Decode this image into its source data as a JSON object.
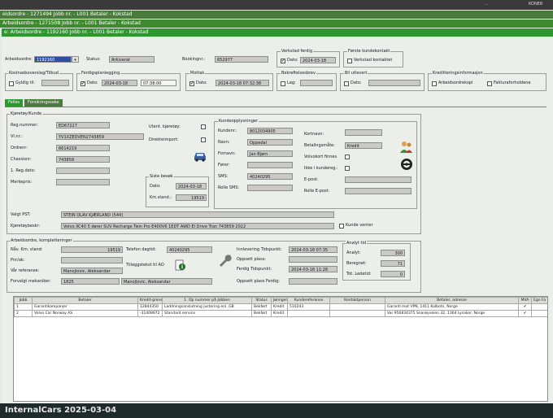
{
  "top_right": {
    "label_1": "...",
    "label_2": "KONER"
  },
  "windows": [
    "eidsordre - 1271494 Jobb nr. - L001 Betaler - Kokstad",
    "Arbeidsordre - 1271508 Jobb nr. - L001 Betaler - Kokstad",
    "e: Arbeidsordre - 1192160 Jobb nr. - L001 Betaler - Kokstad"
  ],
  "header": {
    "arbeidsordre_label": "Arbeidsordre:",
    "arbeidsordre_value": "1192160",
    "status_label": "Status:",
    "status_value": "Arkiverat",
    "bookingnr_label": "Bookingnr.:",
    "bookingnr_value": "652977",
    "verkstad_ferdig": {
      "title": "Verkstad ferdig",
      "dato_label": "Dato:",
      "dato_value": "2024-03-18"
    },
    "forste_kundekontakt": {
      "title": "Første kundekontakt",
      "check_label": "Verkstad kontaktet"
    },
    "kostnadsoverslag": {
      "title": "Kostnadsoverslag/Tilbud",
      "gyldig_label": "Gyldig til:"
    },
    "ferdigplanlegging": {
      "title": "Ferdigsplanlegging",
      "dato_label": "Dato:",
      "dato_value": "2024-03-18",
      "time_value": "07:38:00"
    },
    "mottak": {
      "title": "Mottak",
      "dato_label": "Dato:",
      "dato_value": "2024-03-18 07:32:38"
    },
    "bekreftelsesbrev": {
      "title": "Bekreftelsesbrev",
      "lag_label": "Lag:"
    },
    "bil_utlevert": {
      "title": "Bil utlevert",
      "dato_label": "Dato:"
    },
    "kredittering": {
      "title": "Kreditteringsinformasjon",
      "check1": "Arbeidsordrekopi",
      "check2": "Fakturaforholdene"
    }
  },
  "tabs": [
    "Felles",
    "Forsikringssake"
  ],
  "kjoretoy": {
    "section_title": "Kjøretøy/Kunde",
    "reg_label": "Reg.nummer:",
    "reg_value": "ED67227",
    "vin_label": "Vl.nr.:",
    "vin_value": "YV1XZEDVEN2743859",
    "ordrenr_label": "Ordrenr:",
    "ordrenr_value": "6614219",
    "chassis_label": "Chassisnr:",
    "chassis_value": "743859",
    "regdato_label": "1. Reg.dato:",
    "merkepris_label": "Merkepris:",
    "utent_label": "Utent. kjøretøy:",
    "direkteimport_label": "Direkteimport:",
    "siste_besok_title": "Siste besøk",
    "siste_dato_label": "Dato:",
    "siste_dato_value": "2024-03-18",
    "km_label": "Km.stand.:",
    "km_value": "19519",
    "valgt_pst_label": "Valgt PST:",
    "valgt_pst_value": "STEIN OLAV KJÆRLAND (544)",
    "beskr_label": "Kjøretøybeskr:",
    "beskr_value": "Volvo XC40 5 dører SUV Recharge Twin Pro E400V6 1EDT AWD El Drive Tran 743859  2022",
    "kunde_venter_label": "Kunde venter"
  },
  "kunde": {
    "title": "Kundeopplysninger",
    "kundenr_label": "Kundenr.:",
    "kundenr_value": "8012034905",
    "navn_label": "Navn:",
    "navn_value": "Oppedal",
    "fornavn_label": "Fornavn:",
    "fornavn_value": "Jan Bjørn",
    "forer_label": "Fører:",
    "sms_label": "SMS:",
    "sms_value": "40240295",
    "rolle_sms_label": "Rolle SMS:",
    "kortnavn_label": "Kortnavn:",
    "betalingsmate_label": "Betalingsmåte:",
    "betalingsmate_value": "Kredit",
    "volvokort_label": "Volvokort finnes",
    "ikke_kundereg_label": "Ikke i kundereg.:",
    "epost_label": "E-post:",
    "rolle_epost_label": "Rolle E-post:"
  },
  "arbeidsordre_kompl": {
    "title": "Arbeidsordre, kompletteringer",
    "km_label": "Nåv. Km. stand:",
    "km_value": "19519",
    "telefon_label": "Telefon dagtid:",
    "telefon_value": "40240295",
    "pnr_label": "Pnr/ak:",
    "var_ref_label": "Vår referanse:",
    "var_ref_value": "Manojlovic, Aleksandar",
    "tilleggstekst_label": "Tilleggstekst til AO",
    "forvalgt_label": "Forvalgt mekaniker:",
    "forvalgt_code": "1825",
    "forvalgt_value": "Manojlovic, Aleksandar",
    "innlevering_label": "Innlevering Tidspunkt:",
    "innlevering_value": "2024-03-18 07:35",
    "oppsett_label": "Oppsett plass:",
    "ferdig_label": "Ferdig Tidspunkt:",
    "ferdig_value": "2024-03-18 11:28",
    "oppsett_ferdig_label": "Oppsett plass Ferdig:",
    "analyt_title": "Analyt tid",
    "analyt_label": "Analyt:",
    "analyt_value": "300",
    "beregnet_label": "Beregnet:",
    "beregnet_value": "71",
    "ledetid_label": "Tot. Ledetid:",
    "ledetid_value": "0"
  },
  "table": {
    "headers": [
      "Jobb",
      "Betaler",
      "Kredit-grense",
      "1. Op nummer på Jobben",
      "Status",
      "Jønngen",
      "Kundereferanse",
      "Kontaktperson",
      "Betaler, adresse",
      "MVA",
      "Egn Fa"
    ],
    "rows": [
      [
        "1",
        "Garantikampanjer",
        "12844350",
        "Laddningsanslutning justering enl. GB",
        "Bekført",
        "Kredit",
        "510243",
        "",
        "Garanti mot VPN, 1411 Kolbotn, Norge",
        "✔",
        ""
      ],
      [
        "2",
        "Volvo Car Norway AS",
        "-31408972",
        "Standard service",
        "Bekført",
        "Kredit",
        "",
        "",
        "Var 956834375 Snarøyveien 32, 1364 Lysaker, Norge",
        "✔",
        ""
      ]
    ]
  },
  "taskbar": {
    "text": "InternalCars 2025-03-04"
  }
}
